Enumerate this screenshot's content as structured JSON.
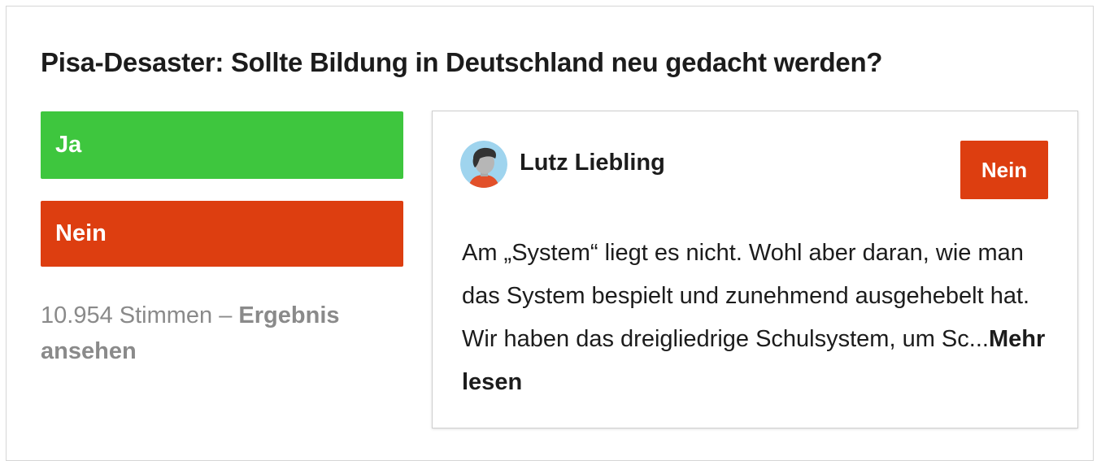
{
  "poll": {
    "question": "Pisa-Desaster: Sollte Bildung in Deutschland neu gedacht werden?",
    "options": [
      {
        "label": "Ja",
        "color": "#3ec63e"
      },
      {
        "label": "Nein",
        "color": "#dd3e10"
      }
    ],
    "vote_count_text": "10.954 Stimmen – ",
    "result_link_label": "Ergebnis ansehen"
  },
  "comment": {
    "avatar_icon": "user-avatar-icon",
    "author": "Lutz Liebling",
    "opinion_badge": "Nein",
    "text": "Am „System“ liegt es nicht. Wohl aber daran, wie man das System bespielt und zunehmend ausgehebelt hat. Wir haben das dreigliedrige Schulsystem, um Sc...",
    "read_more_label": "Mehr lesen"
  }
}
